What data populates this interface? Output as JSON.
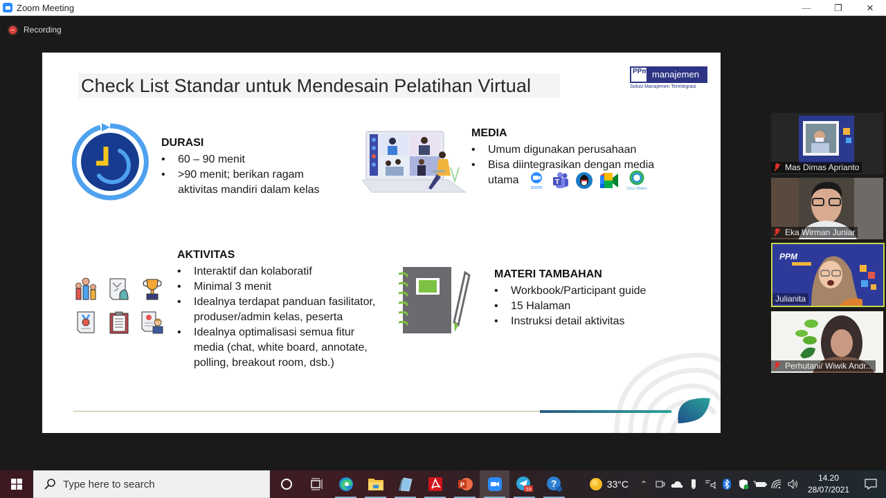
{
  "window": {
    "title": "Zoom Meeting",
    "controls": {
      "minimize": "—",
      "restore": "❐",
      "close": "✕"
    }
  },
  "meeting": {
    "recording_label": "Recording"
  },
  "slide": {
    "title": "Check List Standar untuk Mendesain Pelatihan Virtual",
    "logo": {
      "ppm": "PPm",
      "brand": "manajemen",
      "tagline": "Solusi Manajemen Terintegrasi"
    },
    "sections": {
      "durasi": {
        "heading": "DURASI",
        "bullets": [
          "60 – 90 menit",
          ">90 menit; berikan ragam aktivitas mandiri dalam kelas"
        ]
      },
      "media": {
        "heading": "MEDIA",
        "bullets": [
          "Umum digunakan perusahaan",
          "Bisa diintegrasikan dengan media utama"
        ],
        "logos": [
          "zoom",
          "microsoft-teams",
          "qq",
          "google-meet",
          "cisco-webex"
        ],
        "logo_labels": {
          "zoom": "zoom",
          "webex": "Cisco Webex"
        }
      },
      "aktivitas": {
        "heading": "AKTIVITAS",
        "bullets": [
          "Interaktif dan kolaboratif",
          "Minimal 3 menit",
          "Idealnya terdapat panduan fasilitator, produser/admin kelas, peserta",
          "Idealnya optimalisasi semua fitur media (chat, white board, annotate, polling, breakout room, dsb.)"
        ],
        "icons": [
          "raised-hands",
          "strategy-chess",
          "trophy",
          "certificate-medal",
          "clipboard-checklist",
          "presenter-document"
        ]
      },
      "materi": {
        "heading": "MATERI TAMBAHAN",
        "bullets": [
          "Workbook/Participant guide",
          "15 Halaman",
          "Instruksi detail aktivitas"
        ]
      }
    }
  },
  "participants": [
    {
      "name": "Mas Dimas Aprianto",
      "muted": true,
      "active": false
    },
    {
      "name": "Eka Wirman Juniar",
      "muted": true,
      "active": false
    },
    {
      "name": "Julianita",
      "muted": false,
      "active": true
    },
    {
      "name": "Perhutani/ Wiwik Andr...",
      "muted": true,
      "active": false
    }
  ],
  "taskbar": {
    "search_placeholder": "Type here to search",
    "apps": [
      "cortana",
      "task-view",
      "edge",
      "file-explorer",
      "notepad-app",
      "acrobat-reader",
      "powerpoint",
      "zoom",
      "telegram",
      "help"
    ],
    "telegram_badge": "59",
    "weather_temp": "33°C",
    "time": "14.20",
    "date": "28/07/2021"
  }
}
